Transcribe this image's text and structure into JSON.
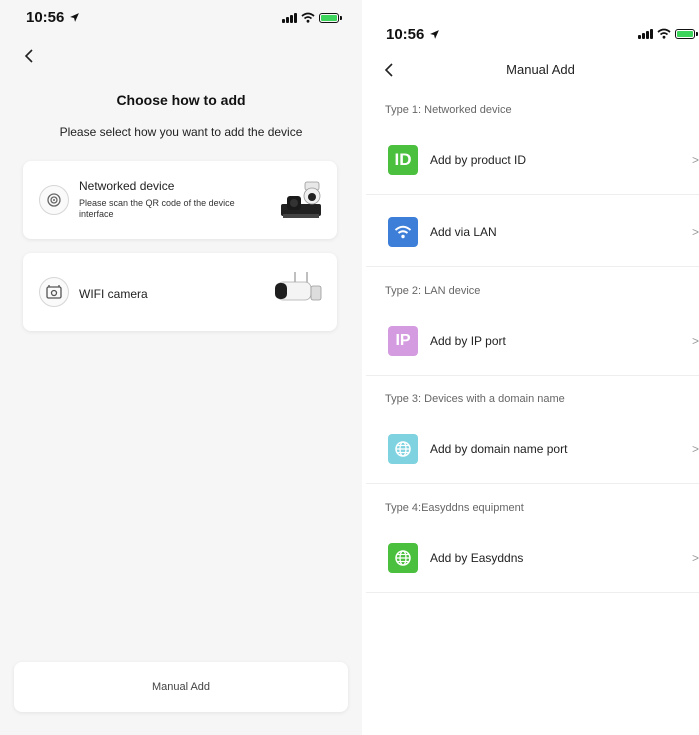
{
  "left": {
    "status_time": "10:56",
    "title": "Choose how to add",
    "subtitle": "Please select how you want to add the device",
    "options": [
      {
        "title": "Networked device",
        "description": "Please scan the QR code of the device interface",
        "icon": "qr-scan-icon"
      },
      {
        "title": "WIFI camera",
        "icon": "wifi-camera-icon"
      }
    ],
    "manual_add_label": "Manual Add"
  },
  "right": {
    "status_time": "10:56",
    "title": "Manual Add",
    "sections": [
      {
        "label": "Type 1: Networked device",
        "items": [
          {
            "label": "Add by product ID",
            "icon": "id-icon",
            "icon_text": "ID",
            "color": "#4bbf3e"
          },
          {
            "label": "Add via LAN",
            "icon": "wifi-icon",
            "color": "#3d7fd8"
          }
        ]
      },
      {
        "label": "Type 2: LAN device",
        "items": [
          {
            "label": "Add by IP port",
            "icon": "ip-icon",
            "icon_text": "IP",
            "color": "#d59be0"
          }
        ]
      },
      {
        "label": "Type 3: Devices with a domain name",
        "items": [
          {
            "label": "Add by domain name port",
            "icon": "globe-icon",
            "color": "#7fd3e0"
          }
        ]
      },
      {
        "label": "Type 4:Easyddns equipment",
        "items": [
          {
            "label": "Add by Easyddns",
            "icon": "globe-icon",
            "color": "#4bbf3e"
          }
        ]
      }
    ],
    "chevron": ">"
  }
}
